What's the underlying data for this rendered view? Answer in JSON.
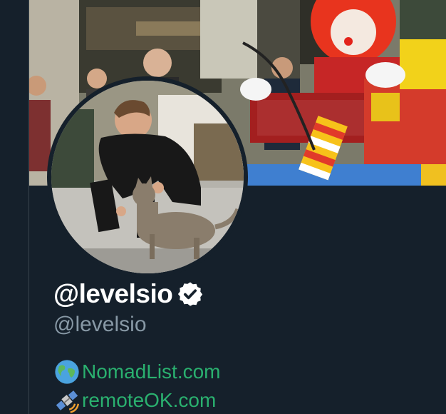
{
  "profile": {
    "display_name": "@levelsio",
    "handle": "@levelsio",
    "verified": true,
    "links": [
      {
        "icon": "globe-icon",
        "label": "NomadList.com"
      },
      {
        "icon": "satellite-icon",
        "label": "remoteOK.com"
      }
    ]
  },
  "colors": {
    "background": "#15202b",
    "link": "#2ab06f",
    "muted": "#8899a6"
  }
}
